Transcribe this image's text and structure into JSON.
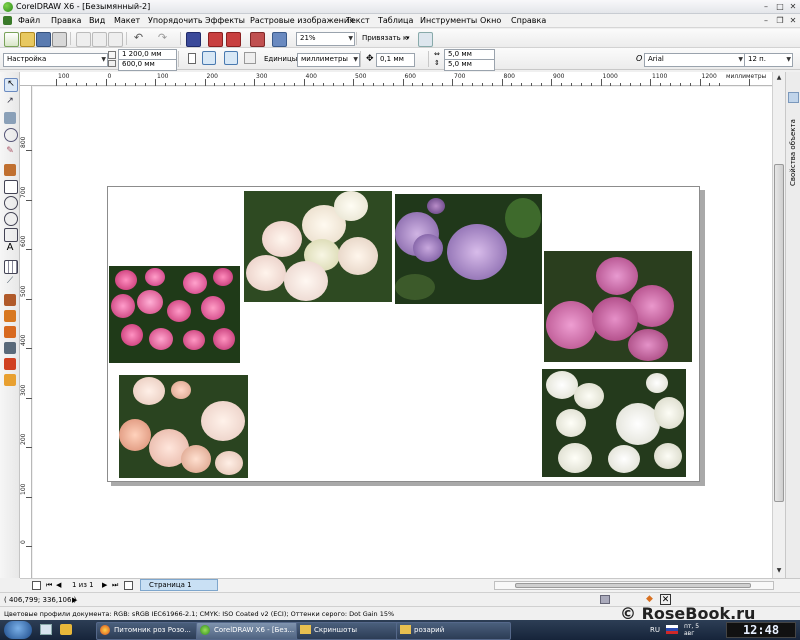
{
  "window": {
    "title": "CorelDRAW X6 - [Безымянный-2]"
  },
  "menu": [
    "Файл",
    "Правка",
    "Вид",
    "Макет",
    "Упорядочить",
    "Эффекты",
    "Растровые изображения",
    "Текст",
    "Таблица",
    "Инструменты",
    "Окно",
    "Справка"
  ],
  "toolbar": {
    "zoom": "21%",
    "snap": "Привязать к"
  },
  "propertybar": {
    "preset": "Настройка",
    "width": "1 200,0 мм",
    "height": "600,0 мм",
    "units_label": "Единицы:",
    "units": "миллиметры",
    "nudge": "0,1 мм",
    "dup_x": "5,0 мм",
    "dup_y": "5,0 мм",
    "font": "Arial",
    "font_size": "12 п."
  },
  "ruler": {
    "unit": "миллиметры",
    "h_labels": [
      "100",
      "0",
      "100",
      "200",
      "300",
      "400",
      "500",
      "600",
      "700",
      "800",
      "900",
      "1000",
      "1100",
      "1200",
      "1300"
    ],
    "v_labels": [
      "800",
      "700",
      "600",
      "500",
      "400",
      "300",
      "200",
      "100",
      "0"
    ]
  },
  "docker": {
    "tab": "Свойства объекта"
  },
  "pagenav": {
    "counter": "1 из 1",
    "tab": "Страница 1"
  },
  "status": {
    "coords": "( 406,799; 336,106 )",
    "color_profiles": "Цветовые профили документа: RGB: sRGB IEC61966-2.1; CMYK: ISO Coated v2 (ECI); Оттенки серого: Dot Gain 15%"
  },
  "watermark": "© RoseBook.ru",
  "taskbar": {
    "tasks": [
      "Питомник роз Розо...",
      "CorelDRAW X6 - [Без...",
      "Скриншоты",
      "розарий"
    ],
    "lang": "RU",
    "day": "пт, 5",
    "month": "авг",
    "time": "12:48"
  },
  "colors": {
    "accent": "#2b8a1c",
    "taskbar": "#1c2a40",
    "page_tab": "#c9e0f4"
  }
}
